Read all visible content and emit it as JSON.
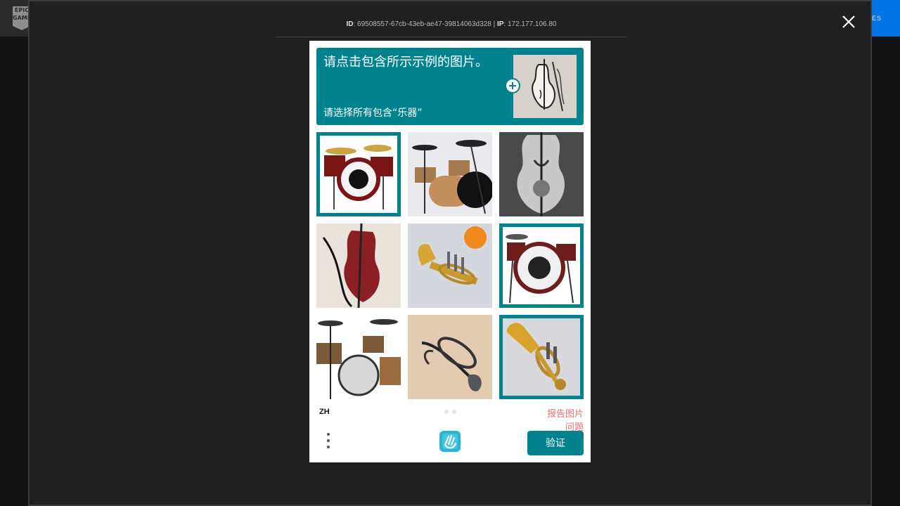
{
  "background": {
    "logo_text": "EPIC GAMES",
    "button_text": "ES"
  },
  "modal": {
    "info_id_label": "ID",
    "info_id_value": ": 69508557-67cb-43eb-ae47-39814063d328 | ",
    "info_ip_label": "IP",
    "info_ip_value": ": 172.177.106.80"
  },
  "captcha": {
    "prompt_title": "请点击包含所示示例的图片。",
    "prompt_subtitle": "请选择所有包含“乐器”",
    "tiles": [
      {
        "icon": "drum-kit",
        "selected": true
      },
      {
        "icon": "drum-kit",
        "selected": false
      },
      {
        "icon": "violin",
        "selected": false
      },
      {
        "icon": "cello",
        "selected": false
      },
      {
        "icon": "trumpet",
        "selected": false
      },
      {
        "icon": "drum-kit",
        "selected": true
      },
      {
        "icon": "drum-kit",
        "selected": false
      },
      {
        "icon": "trumpet",
        "selected": false
      },
      {
        "icon": "trumpet",
        "selected": true
      }
    ],
    "language": "ZH",
    "report_label": "报告图片问题",
    "verify_label": "验证"
  },
  "colors": {
    "accent": "#00838f",
    "report": "#e57373"
  }
}
